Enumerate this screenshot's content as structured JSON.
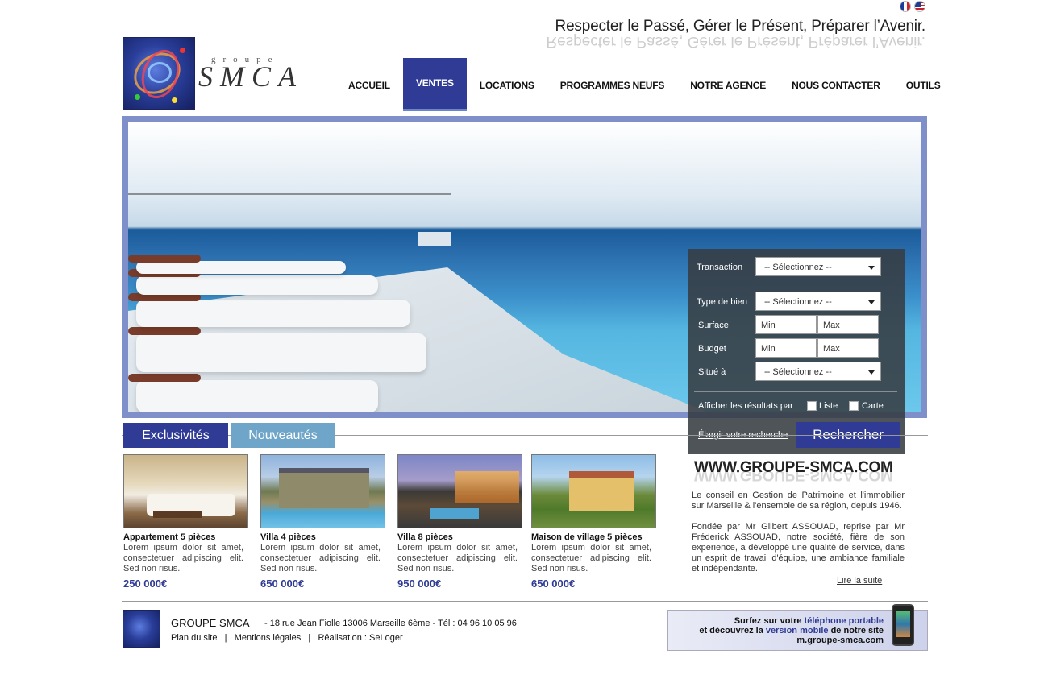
{
  "languages": {
    "fr_icon": "flag-fr-icon",
    "en_icon": "flag-en-icon"
  },
  "header": {
    "slogan": "Respecter le Passé, Gérer le Présent, Préparer l’Avenir.",
    "logo_small": "groupe",
    "logo_main": "SMCA"
  },
  "nav": {
    "items": [
      "ACCUEIL",
      "VENTES",
      "LOCATIONS",
      "PROGRAMMES NEUFS",
      "NOTRE AGENCE",
      "NOUS CONTACTER",
      "OUTILS"
    ],
    "active": "VENTES"
  },
  "search": {
    "transaction_label": "Transaction",
    "transaction_value": "-- Sélectionnez --",
    "type_label": "Type de bien",
    "type_value": "-- Sélectionnez --",
    "surface_label": "Surface",
    "surface_min": "Min",
    "surface_max": "Max",
    "budget_label": "Budget",
    "budget_min": "Min",
    "budget_max": "Max",
    "situe_label": "Situé à",
    "situe_value": "-- Sélectionnez --",
    "afficher_label": "Afficher les résultats par",
    "option_liste": "Liste",
    "option_carte": "Carte",
    "elargir_link": "Élargir votre recherche",
    "search_button": "Rechercher"
  },
  "tabs": {
    "exclusivites": "Exclusivités",
    "nouveautes": "Nouveautés"
  },
  "listings": [
    {
      "title": "Appartement 5 pièces",
      "desc": "Lorem ipsum dolor sit amet, consectetuer adipiscing elit. Sed non risus.",
      "price": "250 000€"
    },
    {
      "title": "Villa 4 pièces",
      "desc": "Lorem ipsum dolor sit amet, consectetuer adipiscing elit. Sed non risus.",
      "price": "650 000€"
    },
    {
      "title": "Villa 8 pièces",
      "desc": "Lorem ipsum dolor sit amet, consectetuer adipiscing elit. Sed non risus.",
      "price": "950 000€"
    },
    {
      "title": "Maison de village 5 pièces",
      "desc": "Lorem ipsum dolor sit amet, consectetuer adipiscing elit. Sed non risus.",
      "price": "650 000€"
    }
  ],
  "about": {
    "site": "WWW.GROUPE-SMCA.COM",
    "p1": "Le conseil en Gestion de Patrimoine et l'immobilier sur Marseille & l'ensemble de sa région, depuis 1946.",
    "p2": "Fondée par Mr Gilbert ASSOUAD, reprise par Mr Fréderick ASSOUAD, notre société, fière de son experience, a développé une qualité de service, dans un esprit de travail d'équipe, une ambiance familiale et indépendante.",
    "read_more": "Lire la suite"
  },
  "footer": {
    "company": "GROUPE SMCA",
    "address": "- 18 rue Jean Fiolle 13006 Marseille 6ème - Tél : 04 96 10 05 96",
    "plan": "Plan du site",
    "mentions": "Mentions légales",
    "realisation": "Réalisation : SeLoger",
    "separator": "|"
  },
  "mobile": {
    "l1a": "Surfez sur votre ",
    "l1b": "téléphone portable",
    "l2a": "et découvrez la ",
    "l2b": "version mobile",
    "l2c": " de notre site",
    "l3": "m.groupe-smca.com"
  },
  "colors": {
    "brand_blue": "#2f3b94",
    "tab_light": "#6fa5c8"
  }
}
